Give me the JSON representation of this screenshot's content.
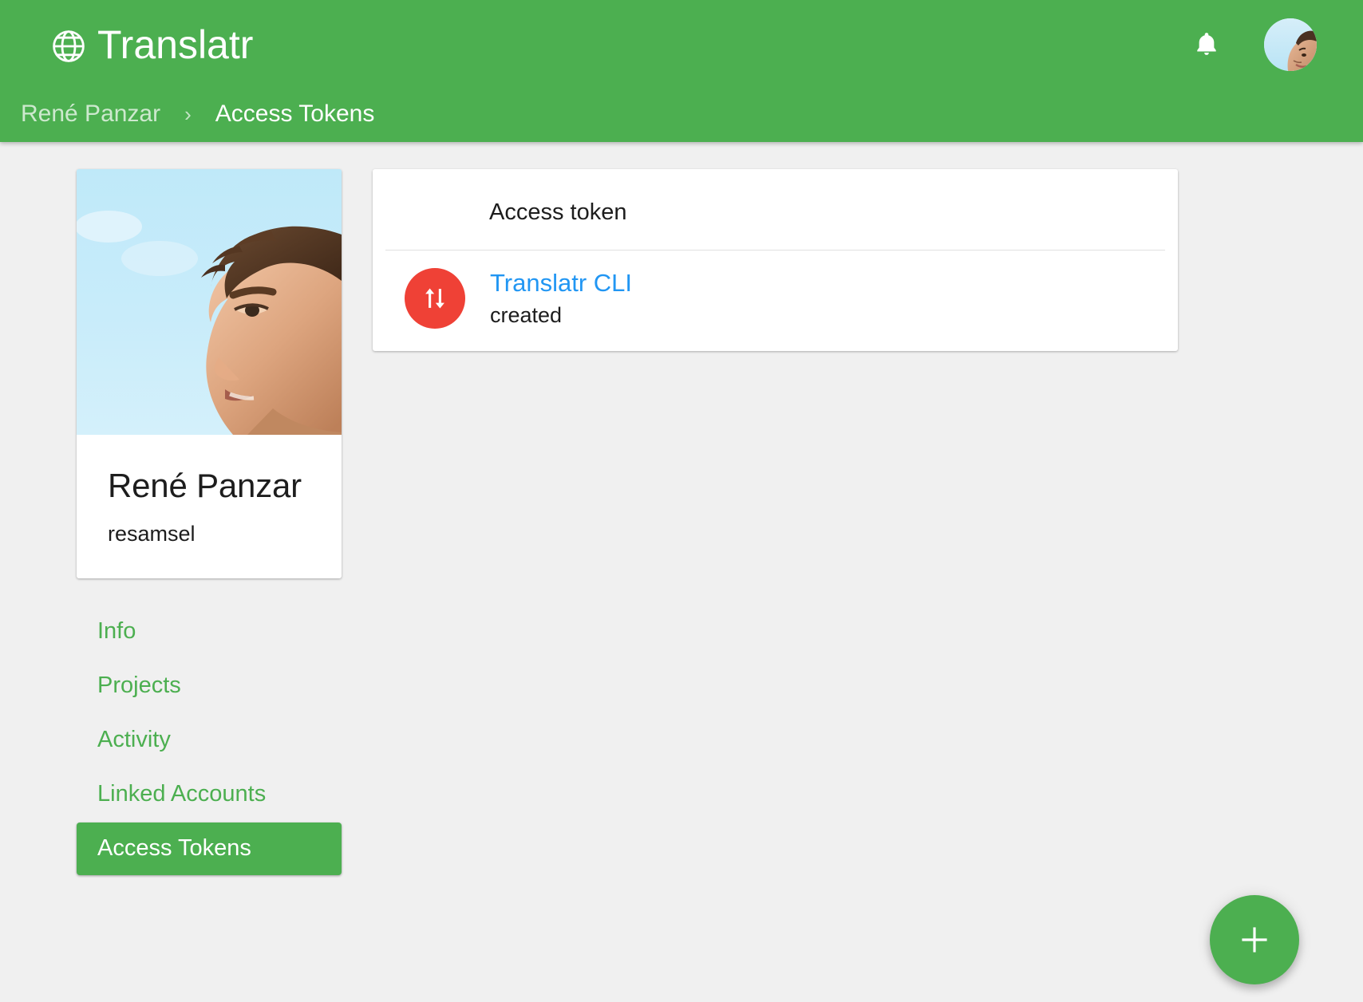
{
  "app": {
    "brand_title": "Translatr",
    "brand_icon": "globe-icon",
    "accent_color": "#4CAF50",
    "link_color": "#2196F3",
    "token_icon_color": "#EF4136",
    "page_background": "#f0f0f0"
  },
  "appbar": {
    "notifications_icon": "bell-icon",
    "avatar_icon": "user-avatar"
  },
  "breadcrumb": {
    "parent": "René Panzar",
    "separator": "›",
    "current": "Access Tokens"
  },
  "profile": {
    "name": "René Panzar",
    "username": "resamsel",
    "photo_alt": "profile-photo"
  },
  "sidebar": {
    "items": [
      {
        "label": "Info",
        "active": false
      },
      {
        "label": "Projects",
        "active": false
      },
      {
        "label": "Activity",
        "active": false
      },
      {
        "label": "Linked Accounts",
        "active": false
      },
      {
        "label": "Access Tokens",
        "active": true
      }
    ]
  },
  "main": {
    "card_title": "Access token",
    "tokens": [
      {
        "name": "Translatr CLI",
        "status": "created",
        "icon": "import-export-icon"
      }
    ]
  },
  "fab": {
    "label": "+",
    "icon": "plus-icon"
  }
}
